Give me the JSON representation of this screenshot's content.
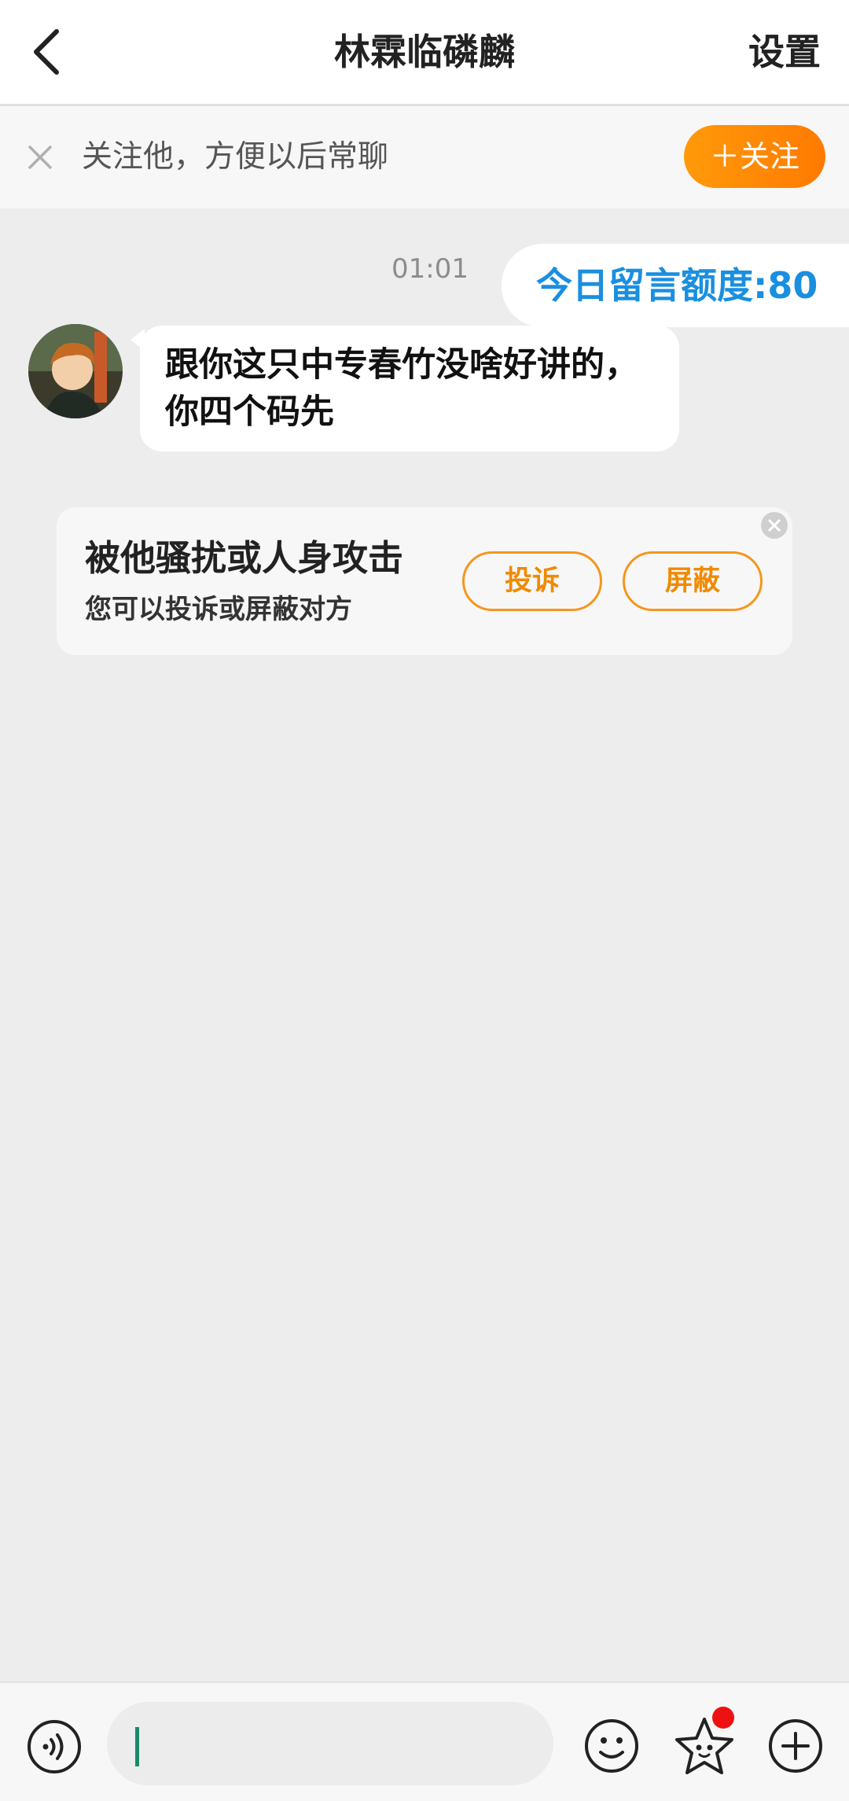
{
  "header": {
    "title": "林霖临磷麟",
    "settings_label": "设置",
    "back_icon": "chevron-left-icon"
  },
  "follow_bar": {
    "prompt": "关注他，方便以后常聊",
    "button_label": "＋关注",
    "close_icon": "close-icon"
  },
  "chat": {
    "timestamp": "01:01",
    "quota_text": "今日留言额度:80",
    "messages": [
      {
        "text": "跟你这只中专春竹没啥好讲的，你四个码先"
      }
    ]
  },
  "report_card": {
    "title": "被他骚扰或人身攻击",
    "subtitle": "您可以投诉或屏蔽对方",
    "complain_label": "投诉",
    "block_label": "屏蔽"
  },
  "colors": {
    "accent_orange": "#ff8a00",
    "quota_blue": "#1a8fe0",
    "background": "#ededed"
  },
  "bottom_bar": {
    "icons": [
      "voice-icon",
      "emoji-icon",
      "star-icon",
      "plus-icon"
    ]
  }
}
